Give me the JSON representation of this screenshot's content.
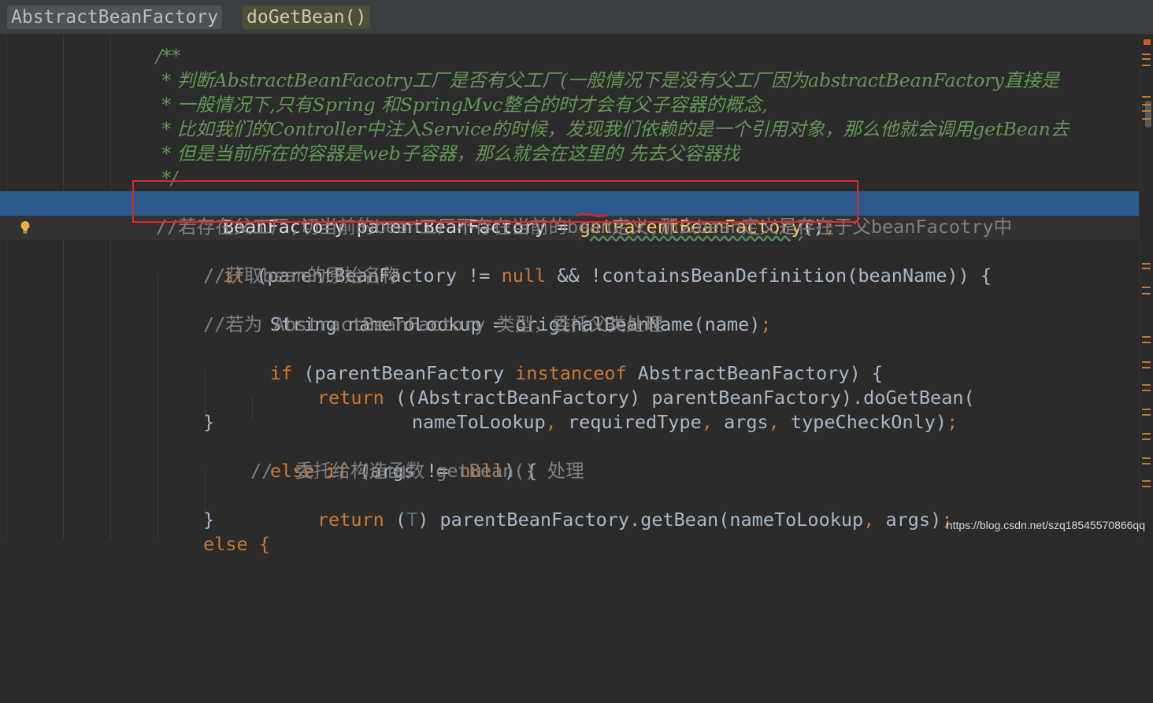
{
  "breadcrumb": {
    "class_name": "AbstractBeanFactory",
    "method_name": "doGetBean()"
  },
  "code": {
    "doc_open": "/**",
    "doc1": " * 判断AbstractBeanFacotry工厂是否有父工厂(一般情况下是没有父工厂因为abstractBeanFactory直接是",
    "doc2": " * 一般情况下,只有Spring 和SpringMvc整合的时才会有父子容器的概念,",
    "doc3": " * 比如我们的Controller中注入Service的时候，发现我们依赖的是一个引用对象，那么他就会调用getBean去",
    "doc4": " * 但是当前所在的容器是web子容器，那么就会在这里的 先去父容器找",
    "doc_close": " */",
    "l_bf_type": "BeanFactory parentBeanFactory = ",
    "l_bf_call": "getParentBeanFactory",
    "l_bf_end": "()",
    "semi": ";",
    "c_parent": "//若存在父工厂,切当前的bean工厂不存在当前的bean定义,那么bean定义是存在于父beanFacotry中",
    "kw_if": "if",
    "if_cond": " (parentBeanFactory != ",
    "kw_null": "null",
    "if_cond2": " && !containsBeanDefinition(beanName)) {",
    "c_orig": "//获取bean的原始名称",
    "l_name": "String nameToLookup = originalBeanName(name)",
    "c_abs": "//若为 AbstractBeanFactory 类型，委托父类处理",
    "if2_open": " (parentBeanFactory ",
    "kw_instanceof": "instanceof",
    "if2_rest": " AbstractBeanFactory) {",
    "kw_return": "return",
    "ret1": " ((AbstractBeanFactory) parentBeanFactory).doGetBean(",
    "ret1_args_a": "nameToLookup",
    "comma": ",",
    "ret1_args_b": " requiredType",
    "ret1_args_c": " args",
    "ret1_args_d": " typeCheckOnly)",
    "close_brace": "}",
    "kw_else": "else",
    "kw_if2": "if",
    "elif_cond": " (args != ",
    "elif_end": ") {",
    "c_ctor": "//  委托给构造函数 getBean() 处理",
    "ret2_a": " (",
    "ret2_T": "T",
    "ret2_b": ") parentBeanFactory.getBean(nameToLookup",
    "ret2_c": " args)",
    "last_else": "else {"
  },
  "watermark": "https://blog.csdn.net/szq18545570866qq"
}
